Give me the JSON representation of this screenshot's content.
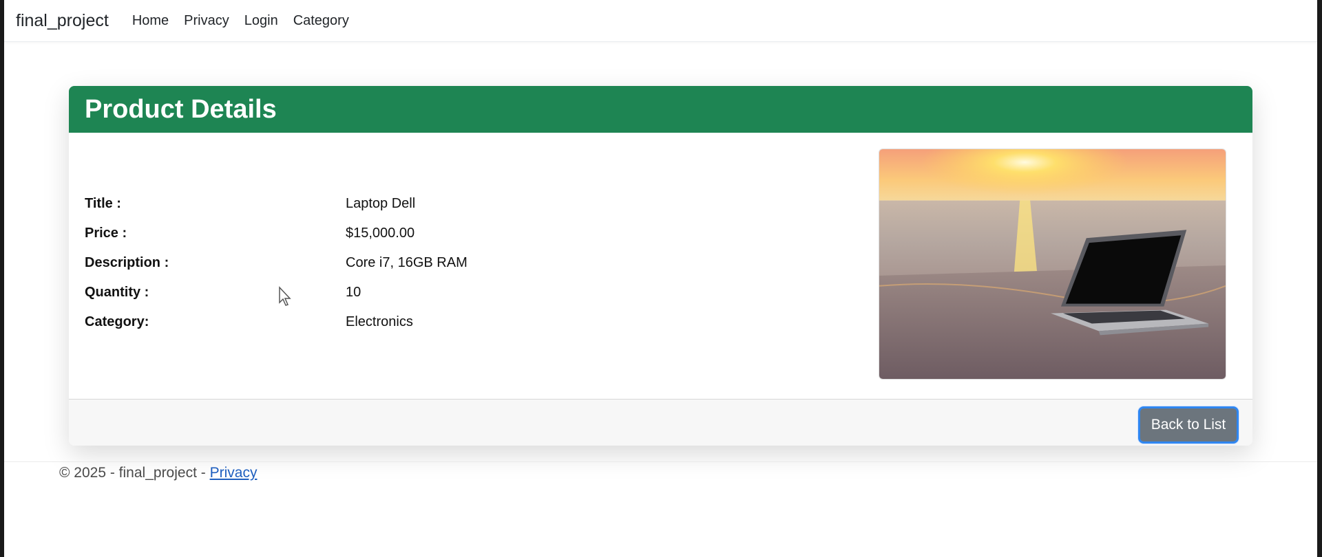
{
  "navbar": {
    "brand": "final_project",
    "links": [
      "Home",
      "Privacy",
      "Login",
      "Category"
    ]
  },
  "card": {
    "title": "Product Details",
    "fields": [
      {
        "label": "Title :",
        "value": "Laptop Dell"
      },
      {
        "label": "Price :",
        "value": "$15,000.00"
      },
      {
        "label": "Description :",
        "value": "Core i7, 16GB RAM"
      },
      {
        "label": "Quantity :",
        "value": "10"
      },
      {
        "label": "Category:",
        "value": "Electronics"
      }
    ],
    "image_icon": "laptop-on-beach-photo",
    "back_button": "Back to List"
  },
  "footer": {
    "copyright": "© 2025 - final_project - ",
    "privacy_link": "Privacy"
  },
  "colors": {
    "header_green": "#1e8553",
    "button_gray": "#6c757d",
    "link_blue": "#1f5fbf"
  }
}
